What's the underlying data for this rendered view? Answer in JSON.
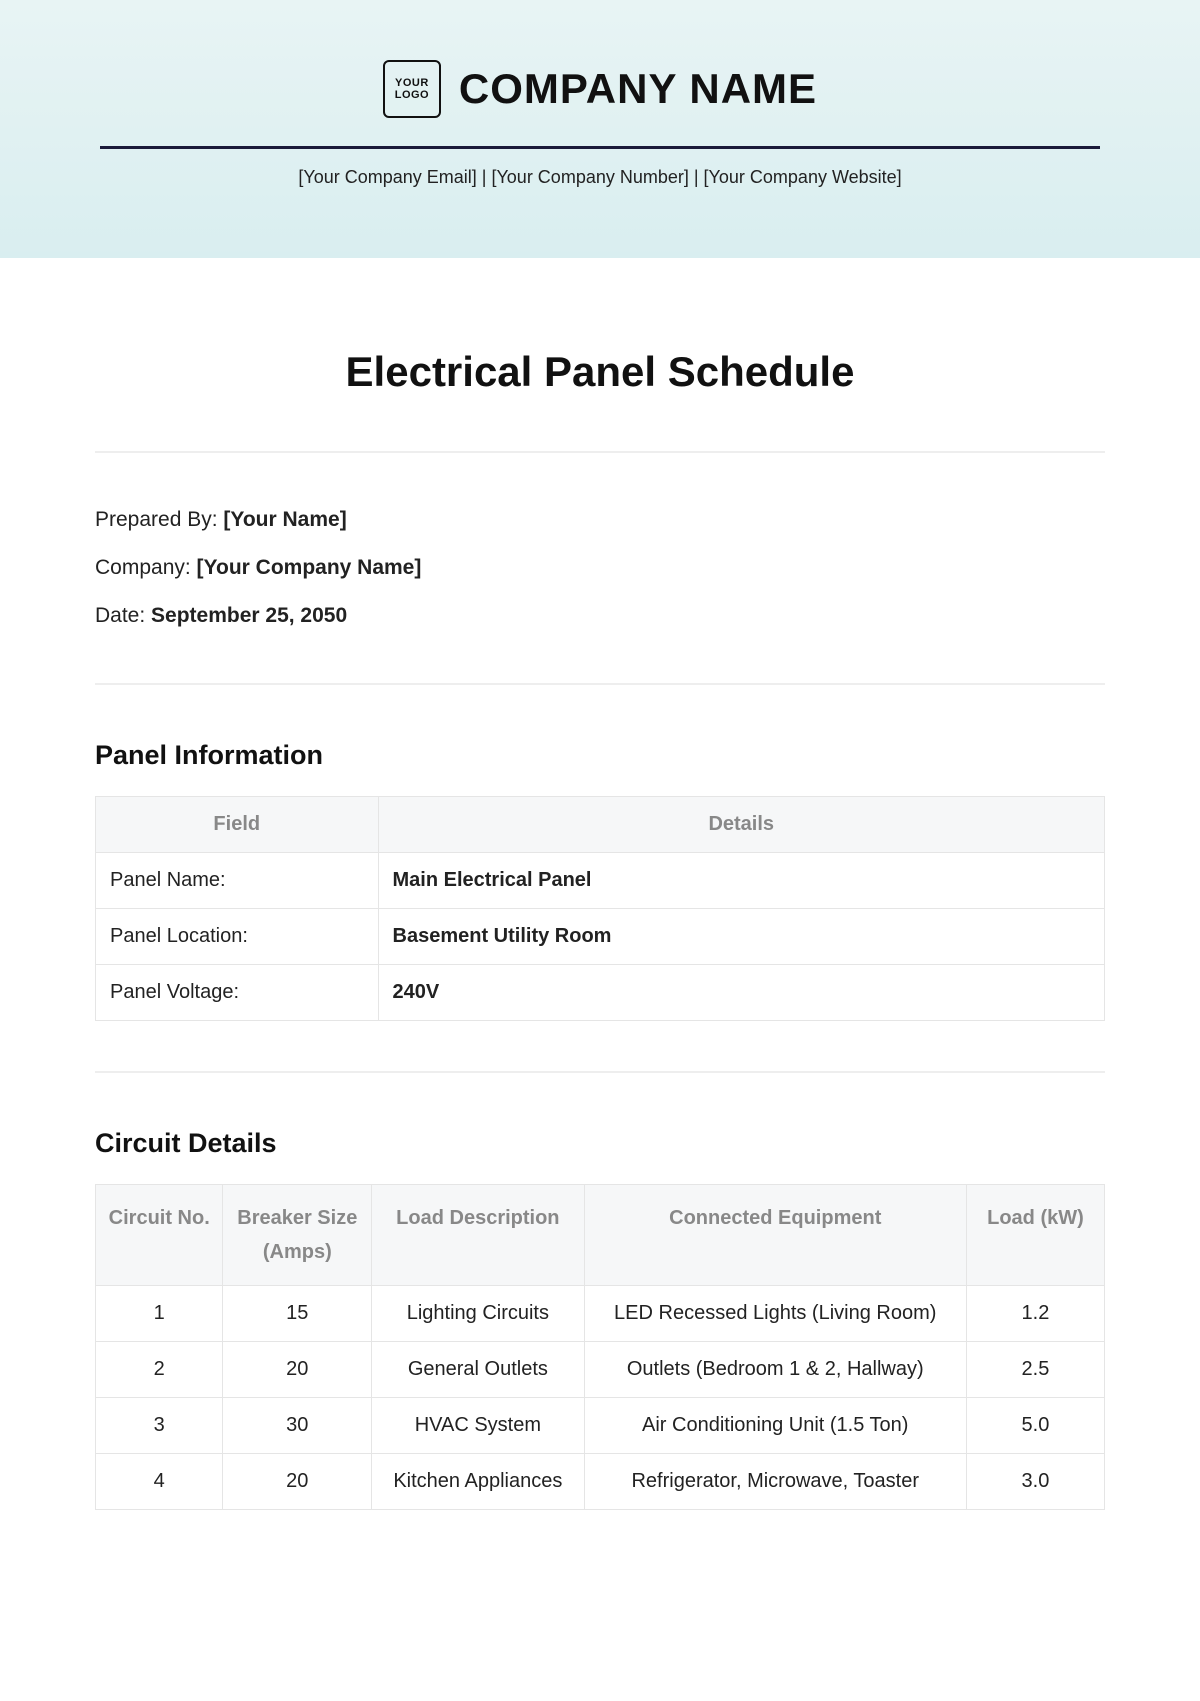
{
  "header": {
    "logo_text": "YOUR LOGO",
    "company_name": "COMPANY NAME",
    "contact_line": "[Your Company Email] | [Your Company Number] | [Your Company Website]"
  },
  "title": "Electrical Panel Schedule",
  "meta": {
    "prepared_by_label": "Prepared By: ",
    "prepared_by_value": "[Your Name]",
    "company_label": "Company: ",
    "company_value": "[Your Company Name]",
    "date_label": "Date: ",
    "date_value": "September 25, 2050"
  },
  "panel_info": {
    "heading": "Panel Information",
    "headers": {
      "field": "Field",
      "details": "Details"
    },
    "rows": [
      {
        "field": "Panel Name:",
        "details": "Main Electrical Panel"
      },
      {
        "field": "Panel Location:",
        "details": "Basement Utility Room"
      },
      {
        "field": "Panel Voltage:",
        "details": "240V"
      }
    ]
  },
  "circuits": {
    "heading": "Circuit Details",
    "headers": {
      "no": "Circuit No.",
      "breaker": "Breaker Size (Amps)",
      "desc": "Load Description",
      "equip": "Connected Equipment",
      "load": "Load (kW)"
    },
    "rows": [
      {
        "no": "1",
        "breaker": "15",
        "desc": "Lighting Circuits",
        "equip": "LED Recessed Lights (Living Room)",
        "load": "1.2"
      },
      {
        "no": "2",
        "breaker": "20",
        "desc": "General Outlets",
        "equip": "Outlets (Bedroom 1 & 2, Hallway)",
        "load": "2.5"
      },
      {
        "no": "3",
        "breaker": "30",
        "desc": "HVAC System",
        "equip": "Air Conditioning Unit (1.5 Ton)",
        "load": "5.0"
      },
      {
        "no": "4",
        "breaker": "20",
        "desc": "Kitchen Appliances",
        "equip": "Refrigerator, Microwave, Toaster",
        "load": "3.0"
      }
    ]
  }
}
